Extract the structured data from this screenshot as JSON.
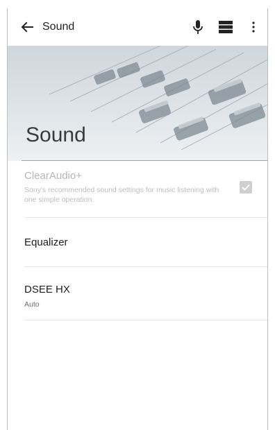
{
  "appbar": {
    "title": "Sound",
    "icons": [
      "back-arrow-icon",
      "microphone-icon",
      "layout-icon",
      "more-vert-icon"
    ]
  },
  "hero": {
    "title": "Sound"
  },
  "settings": {
    "clearaudio": {
      "title": "ClearAudio+",
      "subtitle": "Sony's recommended sound settings for music listening with one simple operation.",
      "checked": true,
      "enabled": false
    },
    "equalizer": {
      "title": "Equalizer"
    },
    "dsee": {
      "title": "DSEE HX",
      "subtitle": "Auto"
    }
  },
  "colors": {
    "background": "#ffffff",
    "disabled_text": "#b5b5b5",
    "divider": "#e3e3e3"
  }
}
